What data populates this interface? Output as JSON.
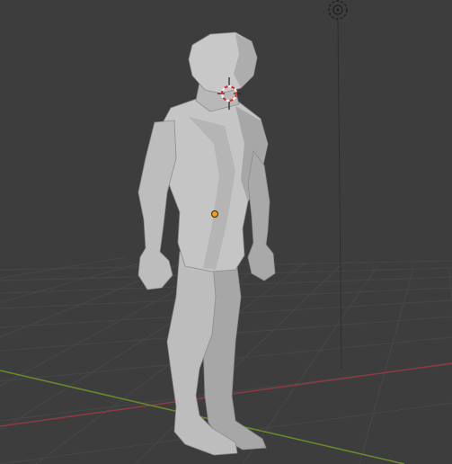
{
  "app": {
    "view": "3D Viewport",
    "shading": "solid"
  },
  "scene": {
    "object": "humanoid-character-mesh",
    "selected_element": "object-origin",
    "cursor": "3d-cursor",
    "camera_icon": "camera-gizmo-icon",
    "grid": true
  },
  "colors": {
    "background": "#3d3d3d",
    "grid_line": "#474747",
    "grid_line_major": "#505050",
    "x_axis": "#8d3a46",
    "y_axis": "#6b8a2a",
    "mesh_light": "#c7c7c7",
    "mesh_mid": "#a9a9a9",
    "mesh_dark": "#8a8a8a",
    "origin": "#f2a01c",
    "cursor_red": "#d43030",
    "cursor_white": "#f0f0f0"
  }
}
